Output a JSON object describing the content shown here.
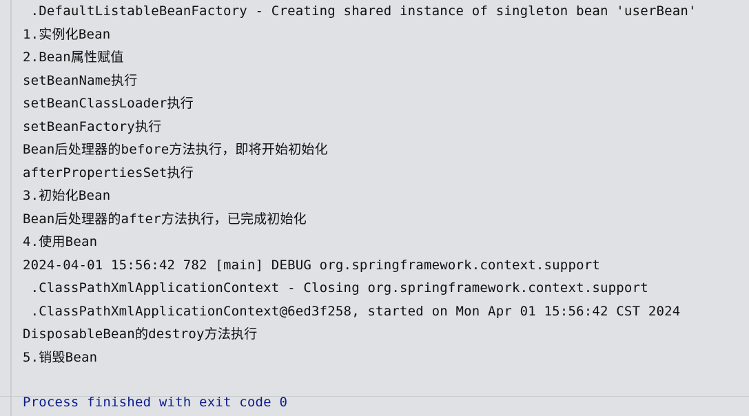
{
  "console": {
    "lines": [
      " .DefaultListableBeanFactory - Creating shared instance of singleton bean 'userBean'",
      "1.实例化Bean",
      "2.Bean属性赋值",
      "setBeanName执行",
      "setBeanClassLoader执行",
      "setBeanFactory执行",
      "Bean后处理器的before方法执行，即将开始初始化",
      "afterPropertiesSet执行",
      "3.初始化Bean",
      "Bean后处理器的after方法执行，已完成初始化",
      "4.使用Bean",
      "2024-04-01 15:56:42 782 [main] DEBUG org.springframework.context.support",
      " .ClassPathXmlApplicationContext - Closing org.springframework.context.support",
      " .ClassPathXmlApplicationContext@6ed3f258, started on Mon Apr 01 15:56:42 CST 2024",
      "DisposableBean的destroy方法执行",
      "5.销毁Bean"
    ],
    "exit_message": "Process finished with exit code 0"
  },
  "colors": {
    "background": "#dfe1e5",
    "text": "#111111",
    "exit_text": "#0b1c8c"
  }
}
